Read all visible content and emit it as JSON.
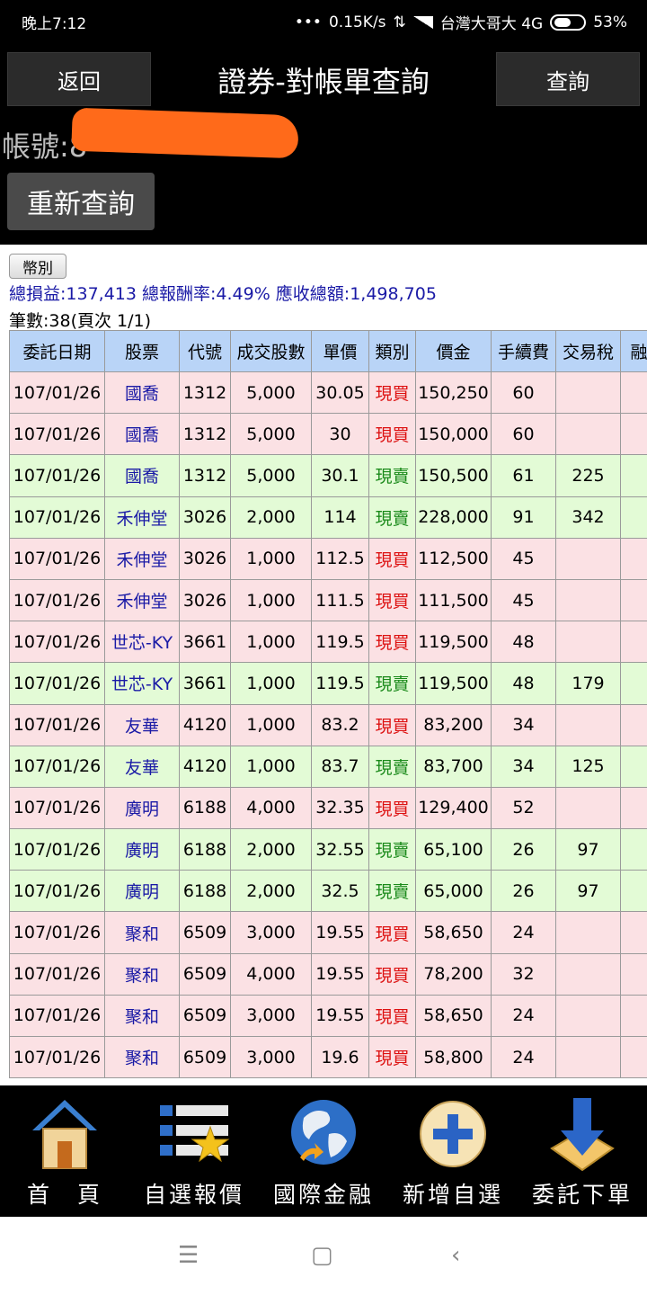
{
  "status_bar": {
    "time": "晚上7:12",
    "network_speed": "0.15K/s",
    "carrier": "台灣大哥大 4G",
    "battery": "53%"
  },
  "header": {
    "back_label": "返回",
    "title": "證券-對帳單查詢",
    "query_label": "查詢",
    "account_label": "帳號:8",
    "requery_label": "重新查詢"
  },
  "summary": {
    "currency_button": "幣別",
    "line": "總損益:137,413 總報酬率:4.49% 應收總額:1,498,705",
    "count": "筆數:38(頁次 1/1)"
  },
  "table": {
    "columns": [
      "委託日期",
      "股票",
      "代號",
      "成交股數",
      "單價",
      "類別",
      "價金",
      "手續費",
      "交易稅",
      "融券"
    ],
    "rows": [
      {
        "date": "107/01/26",
        "name": "國喬",
        "code": "1312",
        "shares": "5,000",
        "price": "30.05",
        "type": "現買",
        "side": "buy",
        "amount": "150,250",
        "fee": "60",
        "tax": ""
      },
      {
        "date": "107/01/26",
        "name": "國喬",
        "code": "1312",
        "shares": "5,000",
        "price": "30",
        "type": "現買",
        "side": "buy",
        "amount": "150,000",
        "fee": "60",
        "tax": ""
      },
      {
        "date": "107/01/26",
        "name": "國喬",
        "code": "1312",
        "shares": "5,000",
        "price": "30.1",
        "type": "現賣",
        "side": "sell",
        "amount": "150,500",
        "fee": "61",
        "tax": "225"
      },
      {
        "date": "107/01/26",
        "name": "禾伸堂",
        "code": "3026",
        "shares": "2,000",
        "price": "114",
        "type": "現賣",
        "side": "sell",
        "amount": "228,000",
        "fee": "91",
        "tax": "342"
      },
      {
        "date": "107/01/26",
        "name": "禾伸堂",
        "code": "3026",
        "shares": "1,000",
        "price": "112.5",
        "type": "現買",
        "side": "buy",
        "amount": "112,500",
        "fee": "45",
        "tax": ""
      },
      {
        "date": "107/01/26",
        "name": "禾伸堂",
        "code": "3026",
        "shares": "1,000",
        "price": "111.5",
        "type": "現買",
        "side": "buy",
        "amount": "111,500",
        "fee": "45",
        "tax": ""
      },
      {
        "date": "107/01/26",
        "name": "世芯-KY",
        "code": "3661",
        "shares": "1,000",
        "price": "119.5",
        "type": "現買",
        "side": "buy",
        "amount": "119,500",
        "fee": "48",
        "tax": ""
      },
      {
        "date": "107/01/26",
        "name": "世芯-KY",
        "code": "3661",
        "shares": "1,000",
        "price": "119.5",
        "type": "現賣",
        "side": "sell",
        "amount": "119,500",
        "fee": "48",
        "tax": "179"
      },
      {
        "date": "107/01/26",
        "name": "友華",
        "code": "4120",
        "shares": "1,000",
        "price": "83.2",
        "type": "現買",
        "side": "buy",
        "amount": "83,200",
        "fee": "34",
        "tax": ""
      },
      {
        "date": "107/01/26",
        "name": "友華",
        "code": "4120",
        "shares": "1,000",
        "price": "83.7",
        "type": "現賣",
        "side": "sell",
        "amount": "83,700",
        "fee": "34",
        "tax": "125"
      },
      {
        "date": "107/01/26",
        "name": "廣明",
        "code": "6188",
        "shares": "4,000",
        "price": "32.35",
        "type": "現買",
        "side": "buy",
        "amount": "129,400",
        "fee": "52",
        "tax": ""
      },
      {
        "date": "107/01/26",
        "name": "廣明",
        "code": "6188",
        "shares": "2,000",
        "price": "32.55",
        "type": "現賣",
        "side": "sell",
        "amount": "65,100",
        "fee": "26",
        "tax": "97"
      },
      {
        "date": "107/01/26",
        "name": "廣明",
        "code": "6188",
        "shares": "2,000",
        "price": "32.5",
        "type": "現賣",
        "side": "sell",
        "amount": "65,000",
        "fee": "26",
        "tax": "97"
      },
      {
        "date": "107/01/26",
        "name": "聚和",
        "code": "6509",
        "shares": "3,000",
        "price": "19.55",
        "type": "現買",
        "side": "buy",
        "amount": "58,650",
        "fee": "24",
        "tax": ""
      },
      {
        "date": "107/01/26",
        "name": "聚和",
        "code": "6509",
        "shares": "4,000",
        "price": "19.55",
        "type": "現買",
        "side": "buy",
        "amount": "78,200",
        "fee": "32",
        "tax": ""
      },
      {
        "date": "107/01/26",
        "name": "聚和",
        "code": "6509",
        "shares": "3,000",
        "price": "19.55",
        "type": "現買",
        "side": "buy",
        "amount": "58,650",
        "fee": "24",
        "tax": ""
      },
      {
        "date": "107/01/26",
        "name": "聚和",
        "code": "6509",
        "shares": "3,000",
        "price": "19.6",
        "type": "現買",
        "side": "buy",
        "amount": "58,800",
        "fee": "24",
        "tax": ""
      }
    ]
  },
  "toolbar": {
    "items": [
      {
        "label": "首　頁",
        "icon": "home-icon"
      },
      {
        "label": "自選報價",
        "icon": "watchlist-star-icon"
      },
      {
        "label": "國際金融",
        "icon": "globe-icon"
      },
      {
        "label": "新增自選",
        "icon": "add-plus-icon"
      },
      {
        "label": "委託下單",
        "icon": "download-arrow-icon"
      }
    ]
  },
  "colors": {
    "header_bg": "#000000",
    "table_header": "#b9d4f7",
    "buy_row": "#fbe1e4",
    "sell_row": "#e3fbd6",
    "buy_text": "#dd1111",
    "sell_text": "#1a8a1a",
    "stock_name": "#1a1aa6",
    "redaction": "#ff6a1a"
  }
}
